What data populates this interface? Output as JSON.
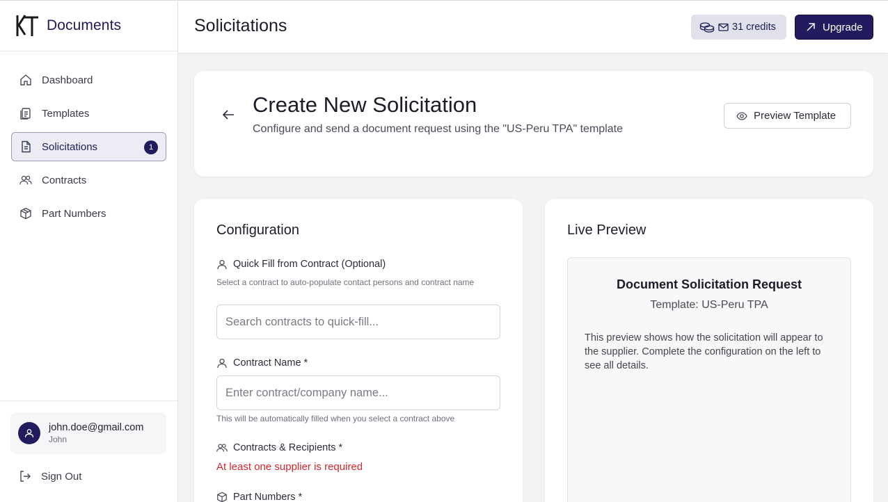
{
  "app": {
    "brand": "Documents"
  },
  "sidebar": {
    "items": [
      {
        "label": "Dashboard",
        "icon": "home-icon"
      },
      {
        "label": "Templates",
        "icon": "templates-icon"
      },
      {
        "label": "Solicitations",
        "icon": "document-icon",
        "badge": "1",
        "active": true
      },
      {
        "label": "Contracts",
        "icon": "users-icon"
      },
      {
        "label": "Part Numbers",
        "icon": "box-icon"
      }
    ],
    "user": {
      "email": "john.doe@gmail.com",
      "name": "John"
    },
    "signout_label": "Sign Out"
  },
  "header": {
    "title": "Solicitations",
    "credits": "31 credits",
    "upgrade_label": "Upgrade"
  },
  "create": {
    "title": "Create New Solicitation",
    "subtitle": "Configure and send a document request using the \"US-Peru TPA\" template",
    "preview_button": "Preview Template"
  },
  "config": {
    "title": "Configuration",
    "quick_fill": {
      "label": "Quick Fill from Contract (Optional)",
      "helper": "Select a contract to auto-populate contact persons and contract name",
      "placeholder": "Search contracts to quick-fill..."
    },
    "contract_name": {
      "label": "Contract Name *",
      "placeholder": "Enter contract/company name...",
      "helper": "This will be automatically filled when you select a contract above"
    },
    "recipients": {
      "label": "Contracts & Recipients *",
      "error": "At least one supplier is required"
    },
    "part_numbers": {
      "label": "Part Numbers *"
    }
  },
  "preview": {
    "title": "Live Preview",
    "doc_title": "Document Solicitation Request",
    "template_line": "Template: US-Peru TPA",
    "description": "This preview shows how the solicitation will appear to the supplier. Complete the configuration on the left to see all details."
  },
  "colors": {
    "brand": "#221b5d",
    "error": "#d3262e",
    "active_bg": "#ececf4"
  }
}
